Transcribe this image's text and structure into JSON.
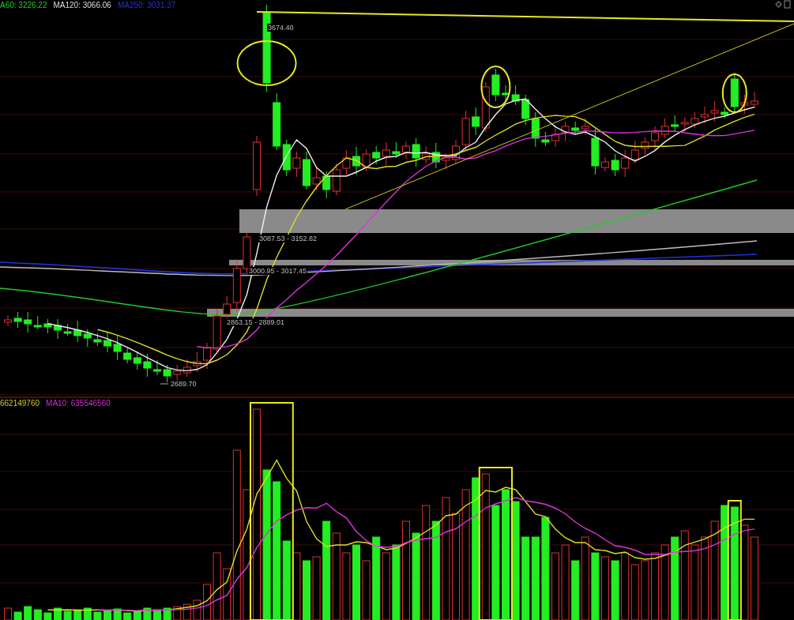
{
  "legend": [
    {
      "text": "A60: 3226.22",
      "color": "#22cc22"
    },
    {
      "text": "MA120: 3066.06",
      "color": "#dddddd"
    },
    {
      "text": "MA250: 3031.37",
      "color": "#2233cc"
    }
  ],
  "price_labels": {
    "high": "3674.40",
    "low": "2689.70"
  },
  "zones": [
    {
      "label": "3087.53 - 3152.82"
    },
    {
      "label": "3000.95 - 3017.45"
    },
    {
      "label": "2863.15 - 2889.01"
    }
  ],
  "volume_legend": [
    {
      "text": "662149760",
      "color": "#cccc33"
    },
    {
      "text": "MA10: 635546560",
      "color": "#cc33cc"
    }
  ]
}
